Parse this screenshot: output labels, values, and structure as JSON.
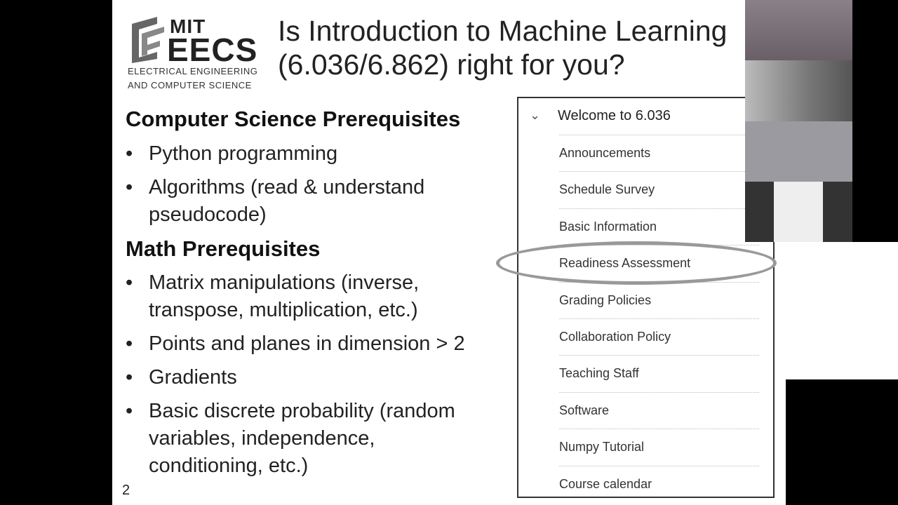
{
  "slide": {
    "logo": {
      "mit": "MIT",
      "eecs": "EECS",
      "line1": "ELECTRICAL ENGINEERING",
      "line2": "AND COMPUTER SCIENCE"
    },
    "title_line1": "Is Introduction to Machine Learning",
    "title_line2": "(6.036/6.862) right for you?",
    "cs_heading": "Computer Science Prerequisites",
    "cs_items": [
      [
        "Python programming"
      ],
      [
        "Algorithms (read & understand",
        "pseudocode)"
      ]
    ],
    "math_heading": "Math Prerequisites",
    "math_items": [
      [
        "Matrix manipulations (inverse,",
        "transpose, multiplication, etc.)"
      ],
      [
        "Points and planes in dimension > 2"
      ],
      [
        "Gradients"
      ],
      [
        "Basic discrete probability (random",
        "variables, independence,",
        "conditioning, etc.)"
      ]
    ],
    "bullet": "•",
    "page_number": "2"
  },
  "nav": {
    "chevron": "⌄",
    "heading": "Welcome to 6.036",
    "items": [
      "Announcements",
      "Schedule Survey",
      "Basic Information",
      "Readiness Assessment",
      "Grading Policies",
      "Collaboration Policy",
      "Teaching Staff",
      "Software",
      "Numpy Tutorial",
      "Course calendar"
    ]
  }
}
